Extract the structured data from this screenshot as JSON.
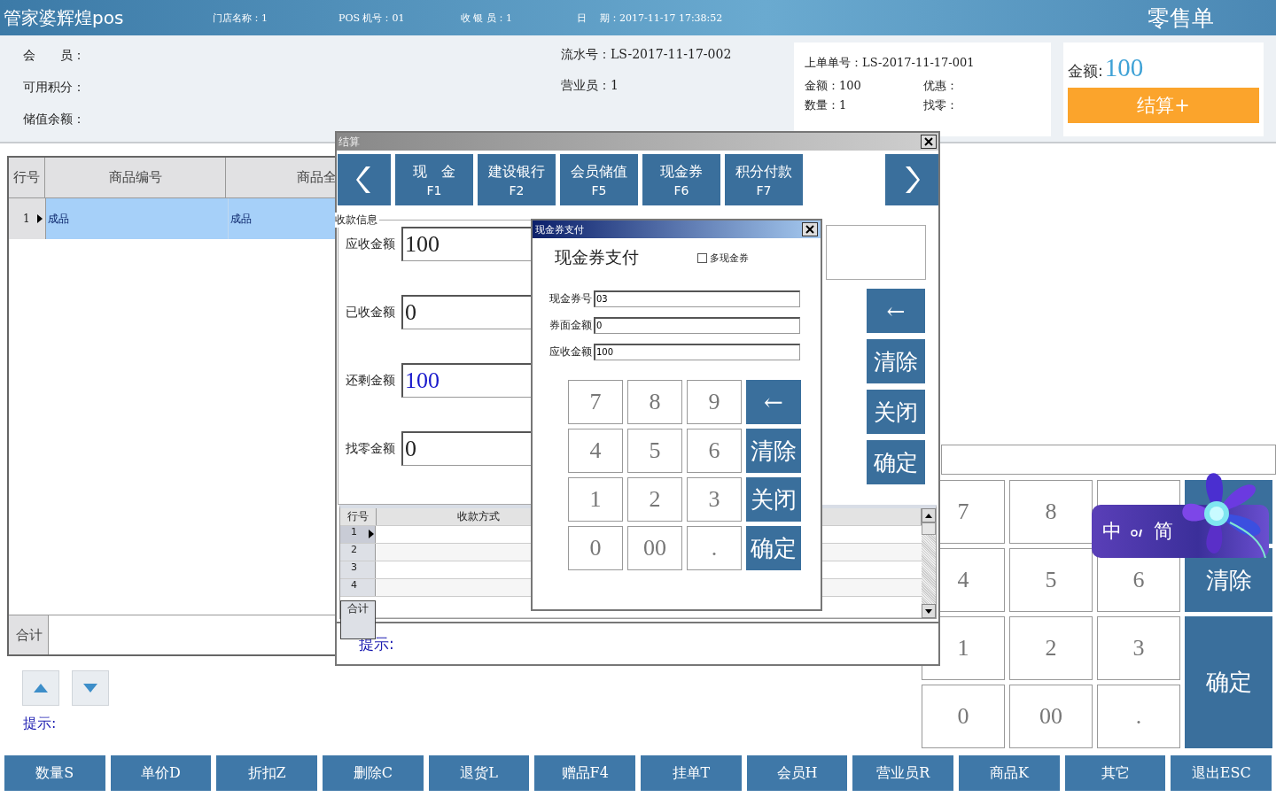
{
  "app_title": "管家婆辉煌pos",
  "header_info": [
    "门店名称：1",
    "POS 机号：01",
    "收 银 员：1"
  ],
  "header_date": {
    "label": "日",
    "value": "期：2017-11-17 17:38:52"
  },
  "doc_type": "零售单",
  "member_info": [
    "会　　员：",
    "可用积分：",
    "储值余额："
  ],
  "serial_info": [
    "流水号：LS-2017-11-17-002",
    "营业员：1"
  ],
  "last_order": {
    "order_no": "上单单号：LS-2017-11-17-001",
    "stats": [
      "金额：100",
      "优惠：",
      "数量：1",
      "找零："
    ]
  },
  "total": {
    "label": "金额:",
    "value": "100"
  },
  "checkout_button": "结算+",
  "items_table": {
    "columns": [
      "行号",
      "商品编号",
      "商品全"
    ],
    "rows": [
      {
        "cells": [
          "1",
          "成品",
          "成品"
        ],
        "selected": true
      }
    ],
    "footer": "合计"
  },
  "hint": "提示:",
  "keypad": [
    {
      "kind": "digit",
      "label": "7"
    },
    {
      "kind": "digit",
      "label": "8"
    },
    {
      "kind": "digit"
    },
    {
      "kind": "action"
    },
    {
      "kind": "digit",
      "label": "4"
    },
    {
      "kind": "digit",
      "label": "5"
    },
    {
      "kind": "digit",
      "label": "6"
    },
    {
      "kind": "action",
      "label": "清除"
    },
    {
      "kind": "digit",
      "label": "1"
    },
    {
      "kind": "digit",
      "label": "2"
    },
    {
      "kind": "digit",
      "label": "3"
    },
    {
      "kind": "confirm",
      "label": "确定"
    },
    {
      "kind": "digit",
      "label": "0"
    },
    {
      "kind": "digit",
      "label": "00"
    },
    {
      "kind": "digit",
      "label": "."
    }
  ],
  "ime_bar": {
    "mode": "中",
    "script": "简"
  },
  "function_buttons": [
    "数量S",
    "单价D",
    "折扣Z",
    "删除C",
    "退货L",
    "赠品F4",
    "挂单T",
    "会员H",
    "营业员R",
    "商品K",
    "其它",
    "退出ESC"
  ],
  "checkout_dialog": {
    "title": "结算",
    "pay_methods": [
      {
        "name": "现　金",
        "key": "F1"
      },
      {
        "name": "建设银行",
        "key": "F2"
      },
      {
        "name": "会员储值",
        "key": "F5"
      },
      {
        "name": "现金券",
        "key": "F6"
      },
      {
        "name": "积分付款",
        "key": "F7"
      }
    ],
    "group_label": "收款信息",
    "fields": [
      {
        "label": "应收金额",
        "value": "100",
        "highlight": false
      },
      {
        "label": "已收金额",
        "value": "0",
        "highlight": false
      },
      {
        "label": "还剩金额",
        "value": "100",
        "highlight": true
      },
      {
        "label": "找零金额",
        "value": "0",
        "highlight": false
      }
    ],
    "keys": [
      "←",
      "清除",
      "关闭",
      "确定"
    ],
    "payments_table": {
      "columns": [
        "行号",
        "收款方式"
      ],
      "rows": [
        {
          "no": "1",
          "current": true
        },
        {
          "no": "2",
          "current": false
        },
        {
          "no": "3",
          "current": false
        },
        {
          "no": "4",
          "current": false
        }
      ],
      "footer": "合计"
    },
    "hint": "提示:"
  },
  "coupon_dialog": {
    "title": "现金券支付",
    "heading": "现金券支付",
    "multi_coupon": {
      "label": "多现金券",
      "checked": false
    },
    "fields": [
      {
        "label": "现金券号",
        "value": "03"
      },
      {
        "label": "券面金额",
        "value": "0"
      },
      {
        "label": "应收金额",
        "value": "100"
      }
    ],
    "keys": [
      {
        "kind": "digit",
        "label": "7"
      },
      {
        "kind": "digit",
        "label": "8"
      },
      {
        "kind": "digit",
        "label": "9"
      },
      {
        "kind": "arrow",
        "label": "←"
      },
      {
        "kind": "digit",
        "label": "4"
      },
      {
        "kind": "digit",
        "label": "5"
      },
      {
        "kind": "digit",
        "label": "6"
      },
      {
        "kind": "action",
        "label": "清除"
      },
      {
        "kind": "digit",
        "label": "1"
      },
      {
        "kind": "digit",
        "label": "2"
      },
      {
        "kind": "digit",
        "label": "3"
      },
      {
        "kind": "action",
        "label": "关闭"
      },
      {
        "kind": "digit",
        "label": "0"
      },
      {
        "kind": "digit",
        "label": "00"
      },
      {
        "kind": "digit",
        "label": "."
      },
      {
        "kind": "action",
        "label": "确定"
      }
    ]
  }
}
